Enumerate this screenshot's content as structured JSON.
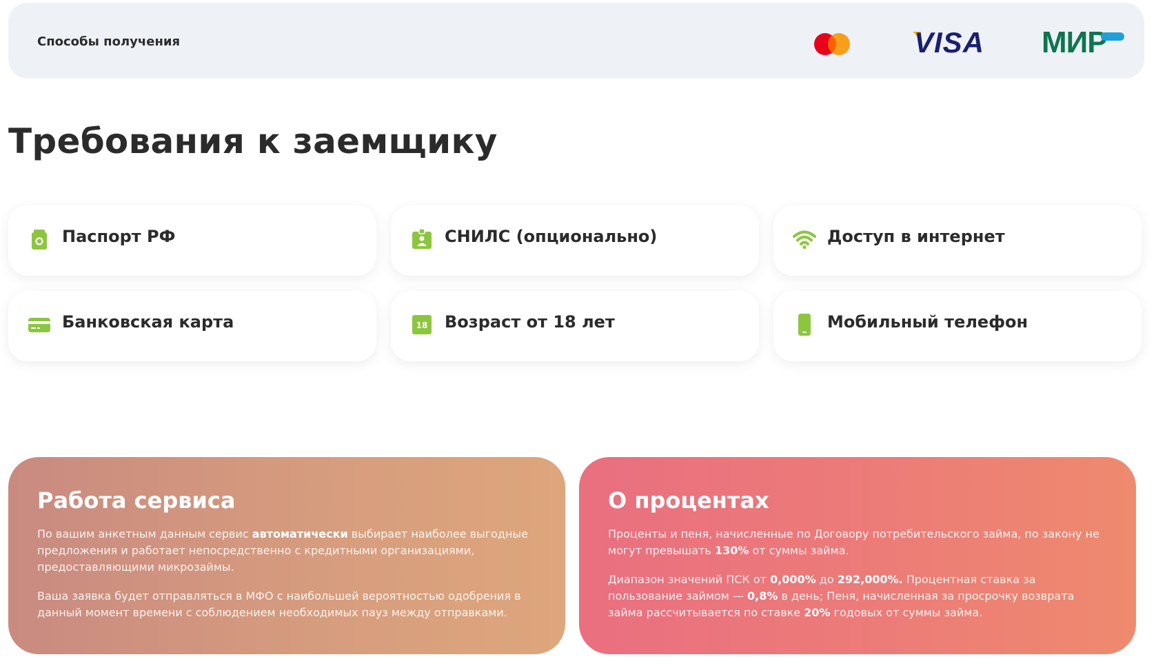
{
  "payment": {
    "label": "Способы получения",
    "logos": [
      "mastercard-logo",
      "visa-logo",
      "mir-logo"
    ],
    "visa_text": "VISA",
    "mir_text": "МИР"
  },
  "requirements": {
    "title": "Требования к заемщику",
    "items": [
      {
        "icon": "passport-icon",
        "label": "Паспорт РФ"
      },
      {
        "icon": "snils-icon",
        "label": "СНИЛС (опционально)"
      },
      {
        "icon": "wifi-icon",
        "label": "Доступ в интернет"
      },
      {
        "icon": "bank-card-icon",
        "label": "Банковская карта"
      },
      {
        "icon": "age-18-icon",
        "label": "Возраст от 18 лет"
      },
      {
        "icon": "mobile-phone-icon",
        "label": "Мобильный телефон"
      }
    ],
    "age_badge": "18"
  },
  "service": {
    "title": "Работа сервиса",
    "p1_a": "По вашим анкетным данным сервис ",
    "p1_b": "автоматически",
    "p1_c": " выбирает наиболее выгодные предложения и работает непосредственно с кредитными организациями, предоставляющими микрозаймы.",
    "p2": "Ваша заявка будет отправляться в МФО с наибольшей вероятностью одобрения в данный момент времени с соблюдением необходимых пауз между отправками."
  },
  "interest": {
    "title": "О процентах",
    "p1_a": "Проценты и пеня, начисленные по Договору потребительского займа, по закону не могут превышать ",
    "p1_b": "130%",
    "p1_c": " от суммы займа.",
    "p2_a": "Диапазон значений ПСК от ",
    "p2_b": "0,000%",
    "p2_c": " до ",
    "p2_d": "292,000%.",
    "p2_e": " Процентная ставка за пользование займом — ",
    "p2_f": "0,8%",
    "p2_g": " в день; Пеня, начисленная за просрочку возврата займа рассчитывается по ставке ",
    "p2_h": "20%",
    "p2_i": " годовых от суммы займа."
  },
  "colors": {
    "accent_green": "#8cc63f",
    "mir_green": "#0f754e",
    "visa_blue": "#1a1f71",
    "visa_gold": "#f7b600",
    "mc_red": "#eb001b",
    "mc_orange": "#f79e1b"
  }
}
